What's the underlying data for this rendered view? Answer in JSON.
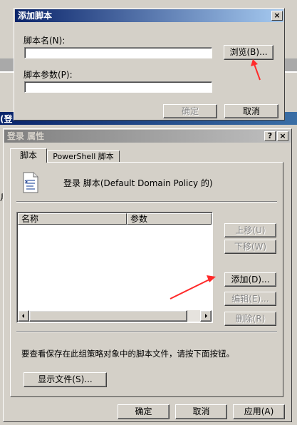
{
  "add_script": {
    "title": "添加脚本",
    "close_icon": "×",
    "name_label": "脚本名(N):",
    "name_value": "",
    "browse_label": "浏览(B)...",
    "params_label": "脚本参数(P):",
    "params_value": "",
    "ok_label": "确定",
    "cancel_label": "取消"
  },
  "properties": {
    "title": "登录 属性",
    "help_icon": "?",
    "close_icon": "×",
    "tabs": [
      {
        "label": "脚本"
      },
      {
        "label": "PowerShell 脚本"
      }
    ],
    "header_text": "登录 脚本(Default Domain Policy 的)",
    "columns": {
      "name": "名称",
      "params": "参数"
    },
    "buttons": {
      "up": "上移(U)",
      "down": "下移(W)",
      "add": "添加(D)...",
      "edit": "编辑(E)...",
      "remove": "删除(R)"
    },
    "note": "要查看保存在此组策略对象中的脚本文件，请按下面按钮。",
    "show_files": "显示文件(S)...",
    "ok": "确定",
    "cancel": "取消",
    "apply": "应用(A)"
  },
  "background": {
    "edge_text_1": "(登",
    "edge_text_2": "月"
  },
  "annotation_color": "#ff2a2a"
}
